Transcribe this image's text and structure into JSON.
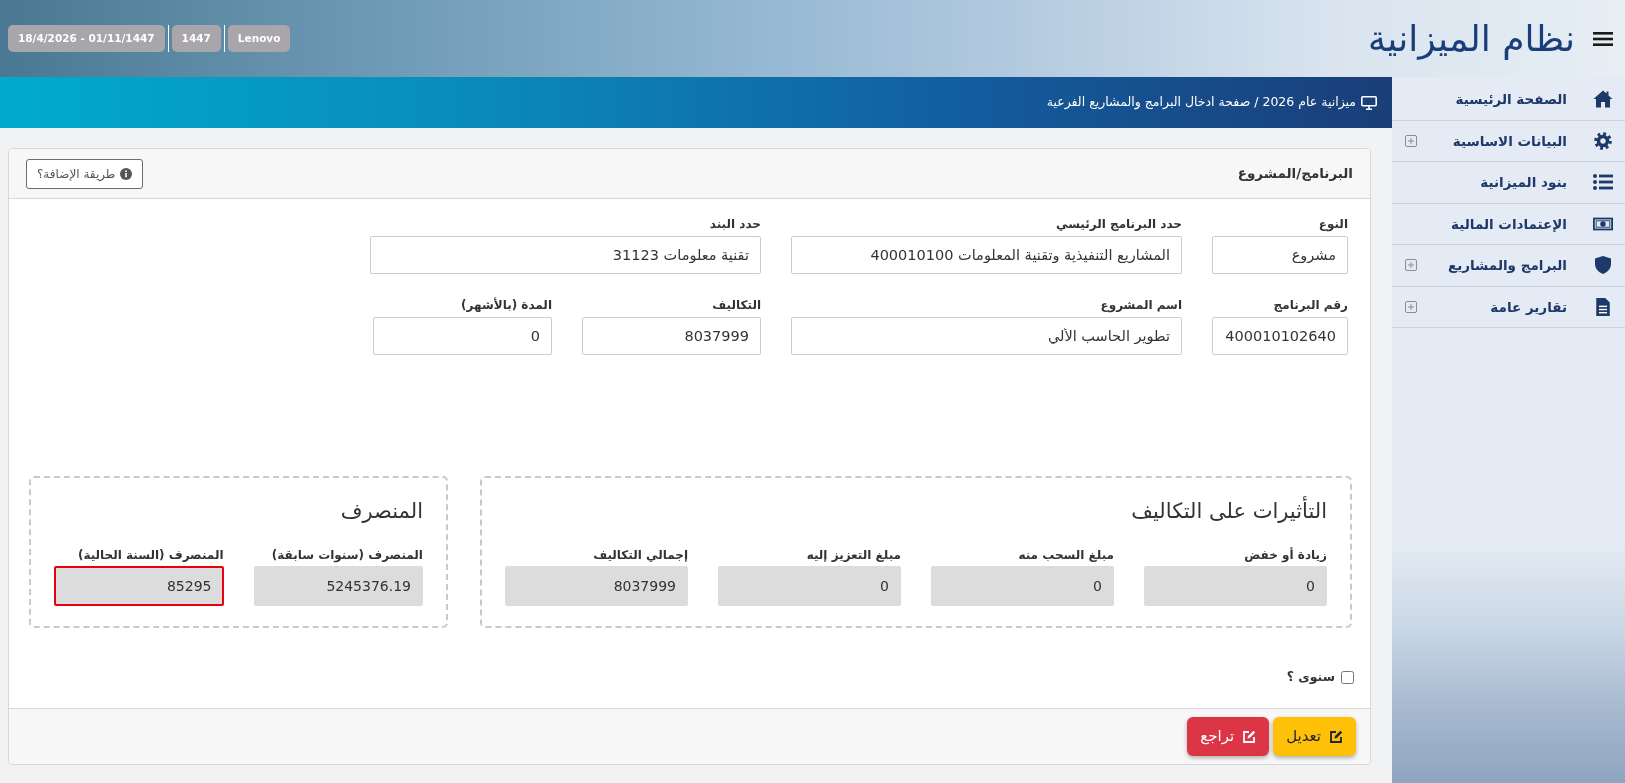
{
  "header": {
    "title": "نظام الميزانية",
    "badges": [
      "Lenovo",
      "1447",
      "18/4/2026 - 01/11/1447"
    ]
  },
  "sidebar": {
    "items": [
      {
        "label": "الصفحة الرئيسية",
        "expandable": false
      },
      {
        "label": "البيانات الاساسية",
        "expandable": true
      },
      {
        "label": "بنود الميزانية",
        "expandable": false
      },
      {
        "label": "الإعتمادات المالية",
        "expandable": false
      },
      {
        "label": "البرامج والمشاريع",
        "expandable": true
      },
      {
        "label": "تقارير عامة",
        "expandable": true
      }
    ]
  },
  "breadcrumb": "ميزانية عام 2026 / صفحة ادخال البرامج والمشاريع الفرعية",
  "card": {
    "title": "البرنامج/المشروع",
    "help_button": "طريقة الإضافة؟",
    "field_rows": [
      [
        {
          "label": "النوع",
          "value": "مشروع"
        },
        {
          "label": "حدد البرنامج الرئيسي",
          "value": "المشاريع التنفيذية وتقنية المعلومات 400010100"
        },
        {
          "label": "حدد البند",
          "value": "تقنية معلومات 31123"
        }
      ],
      [
        {
          "label": "رقم البرنامج",
          "value": "400010102640"
        },
        {
          "label": "اسم المشروع",
          "value": "تطوير الحاسب الألي"
        },
        {
          "label": "التكاليف",
          "value": "8037999"
        },
        {
          "label": "المدة (بالأشهر)",
          "value": "0"
        }
      ]
    ],
    "panels": [
      {
        "title": "التأثيرات على التكاليف",
        "fields": [
          {
            "label": "زيادة أو خفض",
            "value": "0",
            "highlighted": false
          },
          {
            "label": "مبلغ السحب منه",
            "value": "0",
            "highlighted": false
          },
          {
            "label": "مبلغ التعزيز إليه",
            "value": "0",
            "highlighted": false
          },
          {
            "label": "إجمالي التكاليف",
            "value": "8037999",
            "highlighted": false
          }
        ]
      },
      {
        "title": "المنصرف",
        "fields": [
          {
            "label": "المنصرف (سنوات سابقة)",
            "value": "5245376.19",
            "highlighted": false
          },
          {
            "label": "المنصرف (السنة الحالية)",
            "value": "85295",
            "highlighted": true
          }
        ]
      }
    ],
    "annual_checkbox": {
      "label": "سنوى ؟",
      "checked": false
    },
    "buttons": [
      {
        "label": "تعديل",
        "kind": "warning"
      },
      {
        "label": "تراجع",
        "kind": "danger"
      }
    ]
  }
}
